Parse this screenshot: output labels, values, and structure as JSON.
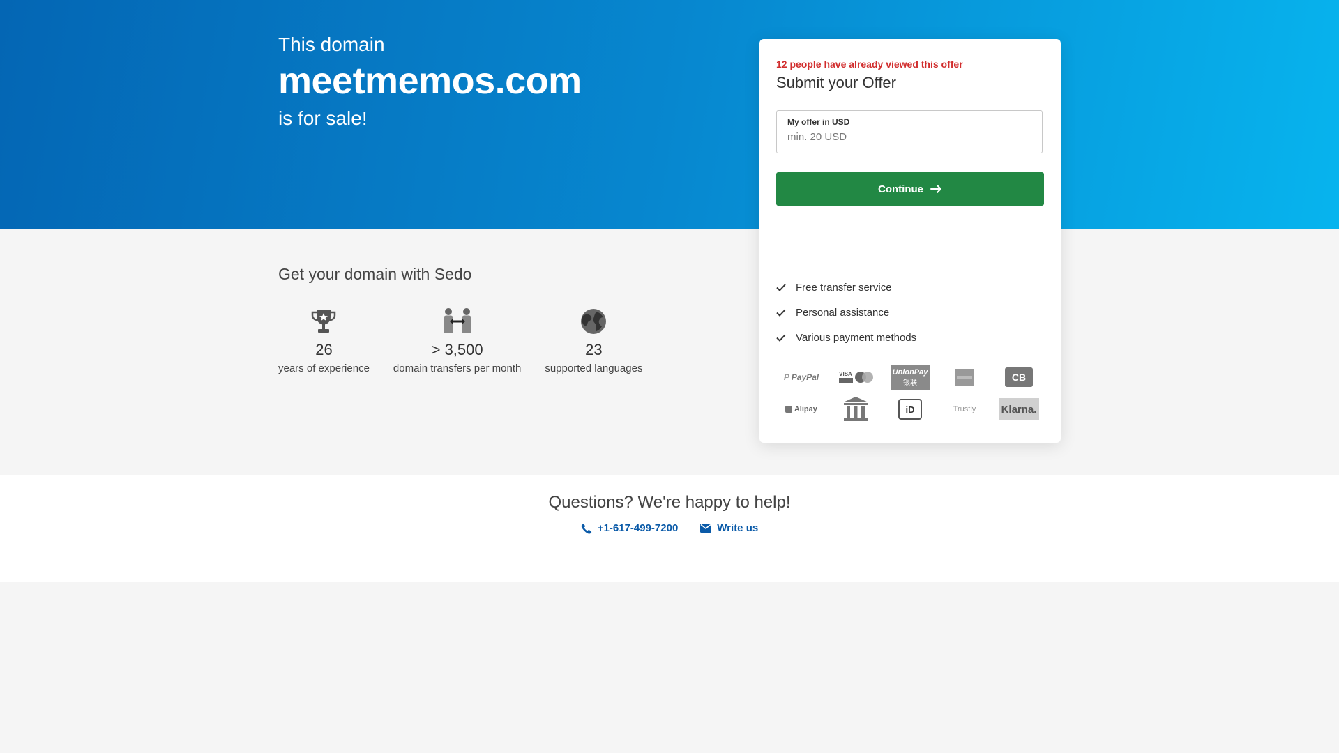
{
  "hero": {
    "pre": "This domain",
    "domain": "meetmemos.com",
    "post": "is for sale!"
  },
  "benefits": {
    "title": "Get your domain with Sedo",
    "stats": [
      {
        "icon": "trophy-icon",
        "value": "26",
        "label": "years of experience"
      },
      {
        "icon": "transfer-people-icon",
        "value": "> 3,500",
        "label": "domain transfers per month"
      },
      {
        "icon": "globe-icon",
        "value": "23",
        "label": "supported languages"
      }
    ]
  },
  "offer": {
    "viewed_text": "12 people have already viewed this offer",
    "title": "Submit your Offer",
    "field_label": "My offer in USD",
    "field_placeholder": "min. 20 USD",
    "field_value": "",
    "continue_label": "Continue",
    "features": [
      "Free transfer service",
      "Personal assistance",
      "Various payment methods"
    ],
    "payment_methods": [
      "PayPal",
      "VISA",
      "UnionPay",
      "AMEX",
      "CB",
      "Alipay",
      "Bank transfer",
      "iDEAL",
      "Trustly",
      "Klarna."
    ],
    "payment_logo_text": {
      "paypal": "PayPal",
      "visa": "VISA",
      "unionpay_en": "UnionPay",
      "unionpay_cn": "银联",
      "cb": "CB",
      "alipay": "Alipay",
      "ideal": "iD",
      "trustly": "Trustly",
      "klarna": "Klarna."
    }
  },
  "help": {
    "title": "Questions? We're happy to help!",
    "phone": "+1-617-499-7200",
    "write": "Write us"
  },
  "colors": {
    "hero_start": "#0466b4",
    "hero_end": "#07b4ee",
    "cta_green": "#228844",
    "alert_red": "#d12d2d",
    "link_blue": "#0a5aa8"
  }
}
